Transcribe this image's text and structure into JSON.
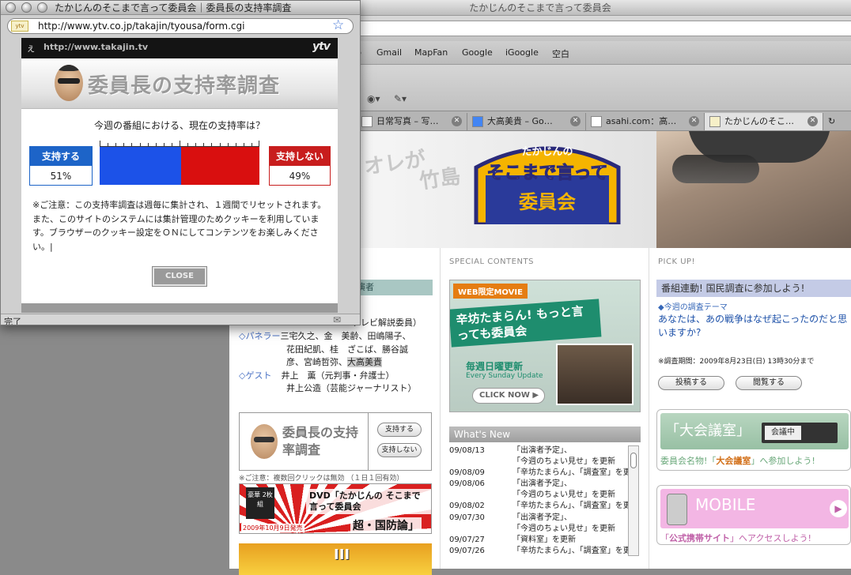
{
  "bg_window": {
    "title": "たかじんのそこまで言って委員会",
    "bookmarks": [
      "p",
      "Gmail",
      "MapFan",
      "Google",
      "iGoogle",
      "空白"
    ],
    "tabs": [
      {
        "label": "日常写真 – 写…"
      },
      {
        "label": "大高美貴 – Go…"
      },
      {
        "label": "asahi.com：高…"
      },
      {
        "label": "たかじんのそこ…"
      }
    ],
    "hero": {
      "ghost_text_1": "オレが",
      "ghost_text_2": "竹島",
      "logo_line1": "たかじんの",
      "logo_line2": "そこまで言って",
      "logo_line3": "委員会"
    },
    "section_heads": {
      "special": "SPECIAL CONTENTS",
      "pickup": "PICK UP!"
    },
    "cast": {
      "head": "演者",
      "commentator": "テレビ解説委員）",
      "lines": [
        {
          "label": "◇パネラー",
          "text": "三宅久之、金　美齢、田嶋陽子、"
        },
        {
          "label": "",
          "text": "花田紀凱、桂　ざこば、勝谷誠"
        },
        {
          "label": "",
          "text": "彦、宮崎哲弥、",
          "highlight": "大高美貴"
        },
        {
          "label": "◇ゲスト",
          "text": "井上　薫（元判事・弁護士）"
        },
        {
          "label": "",
          "text": "井上公造（芸能ジャーナリスト）"
        }
      ]
    },
    "poll_box": {
      "title": "委員長の支持率調査",
      "support_btn": "支持する",
      "nosupport_btn": "支持しない",
      "note": "※ご注意：複数回クリックは無効 （１日１回有効）"
    },
    "dvd_banner": {
      "title": "DVD「たかじんの そこまで言って委員会",
      "subtitle": "超・国防論」",
      "badge": "豪華 2枚組",
      "date": "2009年10月9日発売"
    },
    "yellow_banner": {
      "text": "III"
    },
    "web_movie": {
      "tag": "WEB限定MOVIE",
      "title": "辛坊たまらん! もっと言っても委員会",
      "every": "毎週日曜更新",
      "every_en": "Every Sunday Update",
      "click": "CLICK NOW"
    },
    "whats_new": {
      "head": "What's New",
      "items": [
        {
          "date": "09/08/13",
          "text": "「出演者予定」、"
        },
        {
          "date": "",
          "text": "「今週のちょい見せ」を更新"
        },
        {
          "date": "09/08/09",
          "text": "「辛坊たまらん」、「調査室」を更新"
        },
        {
          "date": "09/08/06",
          "text": "「出演者予定」、"
        },
        {
          "date": "",
          "text": "「今週のちょい見せ」を更新"
        },
        {
          "date": "09/08/02",
          "text": "「辛坊たまらん」、「調査室」を更新"
        },
        {
          "date": "09/07/30",
          "text": "「出演者予定」、"
        },
        {
          "date": "",
          "text": "「今週のちょい見せ」を更新"
        },
        {
          "date": "09/07/27",
          "text": "「資料室」を更新"
        },
        {
          "date": "09/07/26",
          "text": "「辛坊たまらん」、「調査室」を更新"
        }
      ]
    },
    "kokumin": {
      "head": "番組連動! 国民調査に参加しよう!",
      "theme": "◆今週の調査テーマ",
      "question": "あなたは、あの戦争はなぜ起こったのだと思いますか?",
      "period": "※調査期間：2009年8月23日(日) 13時30分まで",
      "post_btn": "投稿する",
      "view_btn": "閲覧する"
    },
    "taikai": {
      "title": "「大会議室」",
      "sign": "会議中",
      "link_prefix": "委員会名物!「",
      "link_bold": "大会議室",
      "link_suffix": "」へ参加しよう!"
    },
    "mobile": {
      "title": "MOBILE",
      "link_prefix": "「",
      "link_bold": "公式携帯サイト",
      "link_suffix": "」へアクセスしよう!"
    }
  },
  "popup": {
    "title": "たかじんのそこまで言って委員会｜委員長の支持率調査",
    "url": "http://www.ytv.co.jp/takajin/tyousa/form.cgi",
    "favicon": "ytv",
    "header_url": "http://www.takajin.tv",
    "header_logo": "ytv",
    "banner_title": "委員長の支持率調査",
    "question": "今週の番組における、現在の支持率は？",
    "support_label": "支持する",
    "support_pct": "51%",
    "support_value": 51,
    "nosupport_label": "支持しない",
    "nosupport_pct": "49%",
    "nosupport_value": 49,
    "note": "※ご注意：この支持率調査は週毎に集計され、１週間でリセットされます。また、このサイトのシステムには集計管理のためクッキーを利用しています。ブラウザーのクッキー設定をＯＮにしてコンテンツをお楽しみください。|",
    "close_label": "CLOSE",
    "status": "完了"
  },
  "colors": {
    "support_blue": "#1c52e8",
    "nosupport_red": "#d90f0f"
  }
}
